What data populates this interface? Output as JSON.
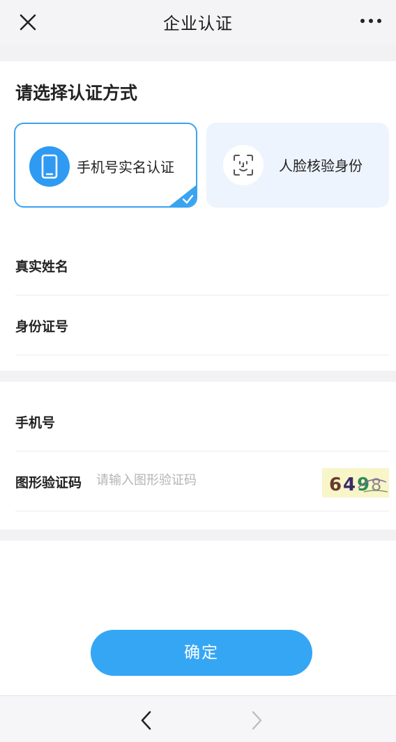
{
  "nav": {
    "title": "企业认证",
    "close_icon": "close-icon",
    "more_icon": "more-dots-icon"
  },
  "auth": {
    "section_title": "请选择认证方式",
    "methods": [
      {
        "label": "手机号实名认证",
        "icon": "phone-icon",
        "selected": true
      },
      {
        "label": "人脸核验身份",
        "icon": "face-scan-icon",
        "selected": false
      }
    ]
  },
  "fields": {
    "real_name_label": "真实姓名",
    "id_number_label": "身份证号",
    "phone_label": "手机号",
    "captcha_label": "图形验证码",
    "captcha_placeholder": "请输入图形验证码",
    "captcha_image_text": "6498"
  },
  "actions": {
    "confirm_label": "确定"
  },
  "colors": {
    "accent": "#35a6f4",
    "selected_border": "#3aa4f0",
    "face_card_bg": "#eef4fd"
  }
}
